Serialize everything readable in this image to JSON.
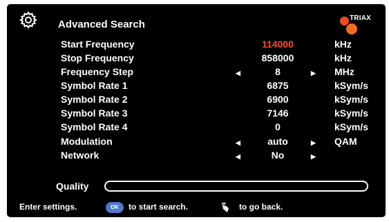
{
  "header": {
    "title": "Advanced Search",
    "settings_icon": "gear-icon",
    "logo_text": "TRIAX",
    "logo_colors": [
      "#ef4b1f",
      "#f06a22"
    ]
  },
  "settings": [
    {
      "label": "Start Frequency",
      "value": "114000",
      "unit": "kHz",
      "arrows": false,
      "highlight": true
    },
    {
      "label": "Stop Frequency",
      "value": "858000",
      "unit": "kHz",
      "arrows": false,
      "highlight": false
    },
    {
      "label": "Frequency Step",
      "value": "8",
      "unit": "MHz",
      "arrows": true,
      "highlight": false
    },
    {
      "label": "Symbol Rate 1",
      "value": "6875",
      "unit": "kSym/s",
      "arrows": false,
      "highlight": false
    },
    {
      "label": "Symbol Rate 2",
      "value": "6900",
      "unit": "kSym/s",
      "arrows": false,
      "highlight": false
    },
    {
      "label": "Symbol Rate 3",
      "value": "7146",
      "unit": "kSym/s",
      "arrows": false,
      "highlight": false
    },
    {
      "label": "Symbol Rate 4",
      "value": "0",
      "unit": "kSym/s",
      "arrows": false,
      "highlight": false
    },
    {
      "label": "Modulation",
      "value": "auto",
      "unit": "QAM",
      "arrows": true,
      "highlight": false
    },
    {
      "label": "Network",
      "value": "No",
      "unit": "",
      "arrows": true,
      "highlight": false
    }
  ],
  "arrows": {
    "left": "◀",
    "right": "▶"
  },
  "quality": {
    "label": "Quality",
    "level_percent": 0
  },
  "footer": {
    "hint": "Enter settings.",
    "ok_label": "OK",
    "ok_text": "to start search.",
    "back_icon": "back-icon",
    "back_text": "to go back."
  },
  "colors": {
    "highlight": "#ff4a35",
    "ok_button": "#4f79c9",
    "background": "#000000",
    "text": "#ffffff"
  }
}
